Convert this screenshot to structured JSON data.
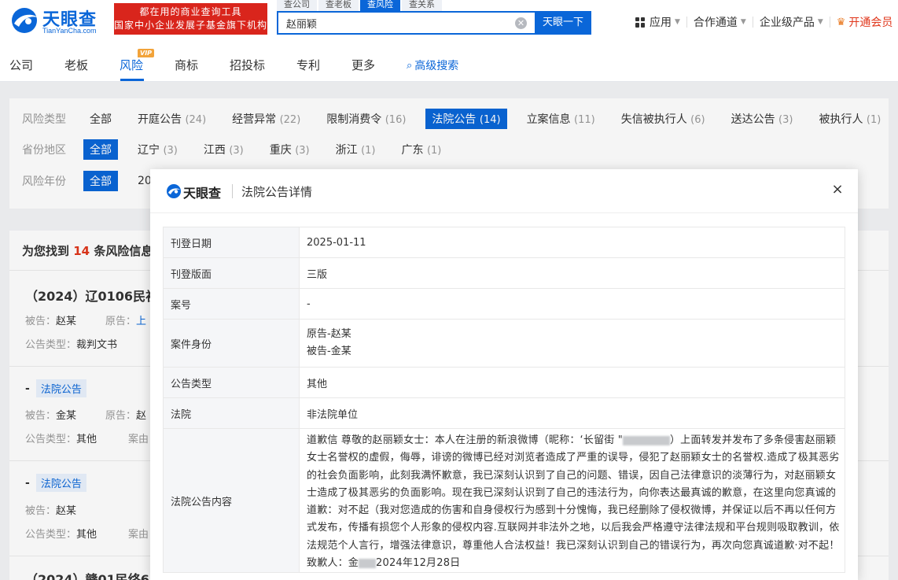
{
  "header": {
    "logo_text": "天眼查",
    "logo_sub": "TianYanCha.com",
    "slogan_line1": "都在用的商业查询工具",
    "slogan_line2": "国家中小企业发展子基金旗下机构",
    "search_tabs": [
      "查公司",
      "查老板",
      "查风险",
      "查关系"
    ],
    "search_value": "赵丽颖",
    "search_button": "天眼一下",
    "nav": {
      "app": "应用",
      "partner": "合作通道",
      "enterprise": "企业级产品",
      "vip": "开通会员"
    }
  },
  "subnav": {
    "items": [
      "公司",
      "老板",
      "风险",
      "商标",
      "招投标",
      "专利",
      "更多",
      "高级搜索"
    ],
    "vip_badge": "VIP"
  },
  "filters": {
    "risk_type": {
      "label": "风险类型",
      "options": [
        {
          "name": "全部",
          "count": ""
        },
        {
          "name": "开庭公告",
          "count": "(24)"
        },
        {
          "name": "经营异常",
          "count": "(22)"
        },
        {
          "name": "限制消费令",
          "count": "(16)"
        },
        {
          "name": "法院公告",
          "count": "(14)"
        },
        {
          "name": "立案信息",
          "count": "(11)"
        },
        {
          "name": "失信被执行人",
          "count": "(6)"
        },
        {
          "name": "送达公告",
          "count": "(3)"
        },
        {
          "name": "被执行人",
          "count": "(1)"
        }
      ]
    },
    "region": {
      "label": "省份地区",
      "options": [
        {
          "name": "全部",
          "count": ""
        },
        {
          "name": "辽宁",
          "count": "(3)"
        },
        {
          "name": "江西",
          "count": "(3)"
        },
        {
          "name": "重庆",
          "count": "(3)"
        },
        {
          "name": "浙江",
          "count": "(1)"
        },
        {
          "name": "广东",
          "count": "(1)"
        }
      ]
    },
    "year": {
      "label": "风险年份",
      "options": [
        {
          "name": "全部",
          "count": ""
        },
        {
          "name": "20",
          "count": ""
        }
      ]
    }
  },
  "results": {
    "found_prefix": "为您找到",
    "found_count": "14",
    "found_suffix": "条风险信息",
    "items": [
      {
        "title": "（2024）辽0106民初",
        "defendant_label": "被告：",
        "defendant": "赵某",
        "plaintiff_label": "原告：",
        "plaintiff": "上",
        "type_label": "公告类型：",
        "type": "裁判文书"
      },
      {
        "tag": "法院公告",
        "defendant_label": "被告：",
        "defendant": "金某",
        "plaintiff_label": "原告：",
        "plaintiff": "赵",
        "type_label": "公告类型：",
        "type": "其他",
        "cause_label": "案由"
      },
      {
        "tag": "法院公告",
        "defendant_label": "被告：",
        "defendant": "赵某",
        "type_label": "公告类型：",
        "type": "其他",
        "cause_label": "案由"
      },
      {
        "title": "（2024）赣01民终6"
      }
    ]
  },
  "modal": {
    "logo_text": "天眼查",
    "title": "法院公告详情",
    "close": "×",
    "rows": [
      {
        "key": "刊登日期",
        "value": "2025-01-11"
      },
      {
        "key": "刊登版面",
        "value": "三版"
      },
      {
        "key": "案号",
        "value": "-"
      },
      {
        "key": "案件身份",
        "value_line1": "原告-赵某",
        "value_line2": "被告-金某"
      },
      {
        "key": "公告类型",
        "value": "其他"
      },
      {
        "key": "法院",
        "value": "非法院单位"
      },
      {
        "key": "法院公告内容",
        "content_a": "道歉信 尊敬的赵丽颖女士：本人在注册的新浪微博（昵称：‘长留街 \"",
        "content_b": "）上面转发并发布了多条侵害赵丽颖女士名誉权的虚假，侮辱，诽谤的微博已经对浏览者造成了严重的误导，侵犯了赵丽颖女士的名誉权.造成了极其恶劣的社会负面影响，此刻我满怀歉意，我已深刻认识到了自己的问题、错误，因自己法律意识的淡薄行为，对赵丽颖女士造成了极其恶劣的负面影响。现在我已深刻认识到了自己的违法行为，向你表达最真诚的歉意，在这里向您真诚的道歉：对不起（我对您造成的伤害和自身侵权行为感到十分愧悔，我已经删除了侵权微博，并保证以后不再以任何方式发布，传播有损您个人形象的侵权内容.互联网并非法外之地，以后我会严格遵守法律法规和平台规则吸取教训，依法规范个人言行，增强法律意识，尊重他人合法权益！我已深刻认识到自己的错误行为，再次向您真诚道歉·对不起！致歉人：金",
        "content_c": "2024年12月28日"
      }
    ]
  },
  "colors": {
    "brand": "#0a66d8",
    "accent_red": "#e0361b",
    "slogan_bg": "#d9251c",
    "vip_badge": "#f2a33a"
  }
}
